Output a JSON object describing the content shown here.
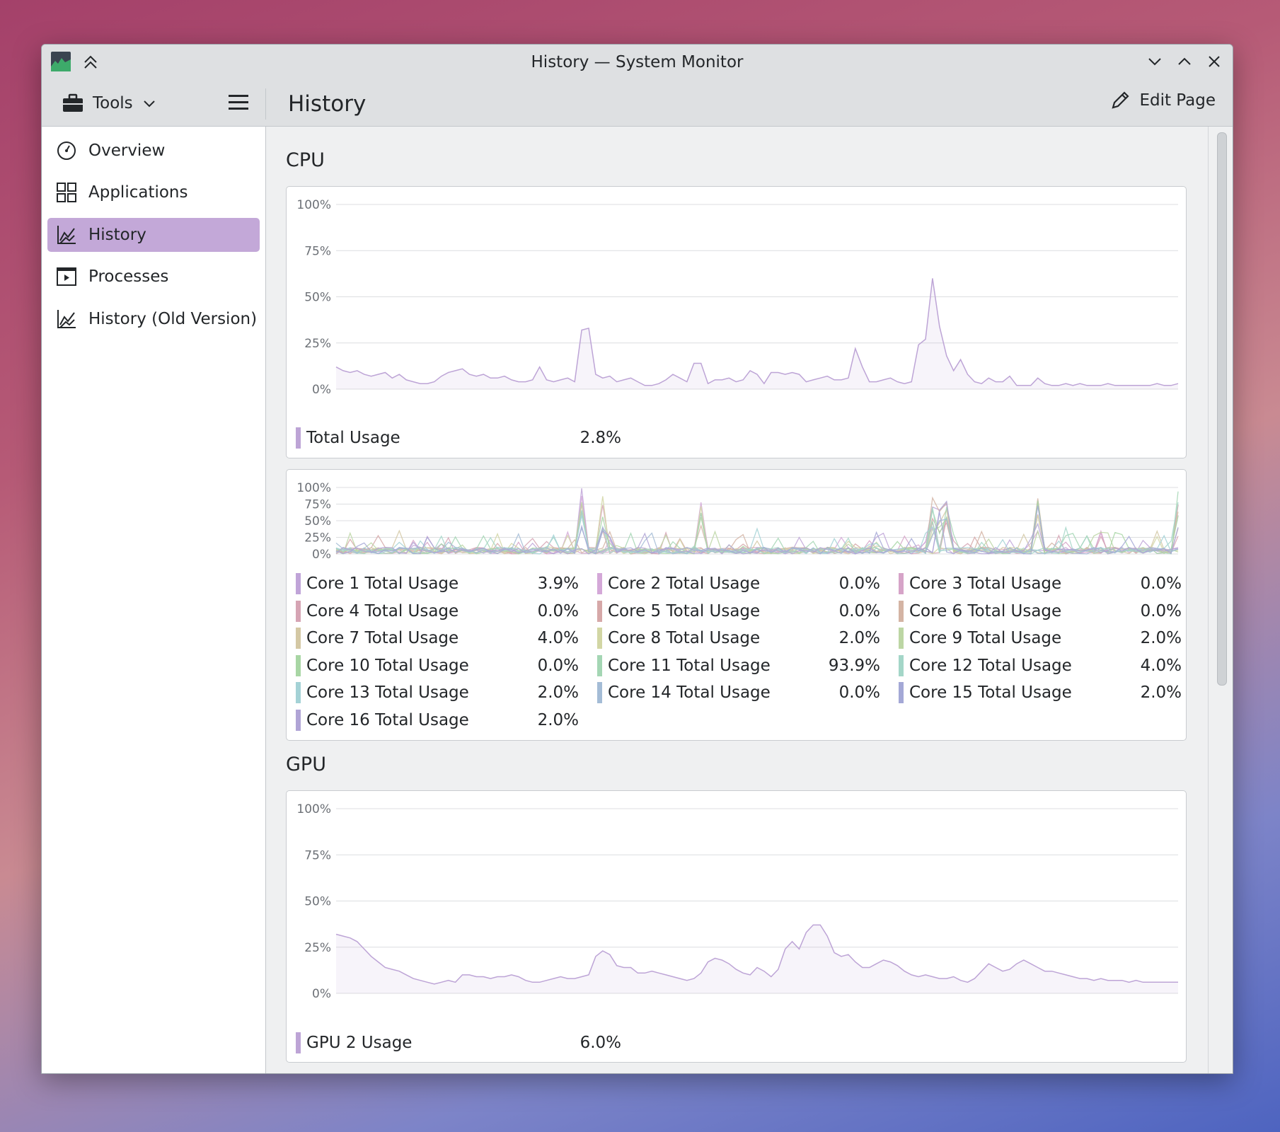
{
  "window": {
    "title": "History — System Monitor"
  },
  "toolbar": {
    "tools_label": "Tools",
    "page_title": "History",
    "edit_label": "Edit Page"
  },
  "sidebar": {
    "items": [
      {
        "label": "Overview",
        "icon": "speedometer-icon"
      },
      {
        "label": "Applications",
        "icon": "grid-icon"
      },
      {
        "label": "History",
        "icon": "chart-icon",
        "active": true
      },
      {
        "label": "Processes",
        "icon": "play-window-icon"
      },
      {
        "label": "History (Old Version)",
        "icon": "chart-icon"
      }
    ]
  },
  "cpu": {
    "heading": "CPU",
    "total": {
      "label": "Total Usage",
      "value": "2.8%",
      "color": "#bda4d6"
    },
    "cores": [
      {
        "label": "Core 1 Total Usage",
        "value": "3.9%",
        "color": "#c0a4d8"
      },
      {
        "label": "Core 2 Total Usage",
        "value": "0.0%",
        "color": "#d4a8d8"
      },
      {
        "label": "Core 3 Total Usage",
        "value": "0.0%",
        "color": "#d6a4c8"
      },
      {
        "label": "Core 4 Total Usage",
        "value": "0.0%",
        "color": "#d6a4b4"
      },
      {
        "label": "Core 5 Total Usage",
        "value": "0.0%",
        "color": "#d6a8a8"
      },
      {
        "label": "Core 6 Total Usage",
        "value": "0.0%",
        "color": "#d4b4a4"
      },
      {
        "label": "Core 7 Total Usage",
        "value": "4.0%",
        "color": "#d4c8a4"
      },
      {
        "label": "Core 8 Total Usage",
        "value": "2.0%",
        "color": "#d2d6a4"
      },
      {
        "label": "Core 9 Total Usage",
        "value": "2.0%",
        "color": "#bcd6a4"
      },
      {
        "label": "Core 10 Total Usage",
        "value": "0.0%",
        "color": "#a8d6a4"
      },
      {
        "label": "Core 11 Total Usage",
        "value": "93.9%",
        "color": "#a4d6b4"
      },
      {
        "label": "Core 12 Total Usage",
        "value": "4.0%",
        "color": "#a4d6c8"
      },
      {
        "label": "Core 13 Total Usage",
        "value": "2.0%",
        "color": "#a4d2d6"
      },
      {
        "label": "Core 14 Total Usage",
        "value": "0.0%",
        "color": "#a4bcd6"
      },
      {
        "label": "Core 15 Total Usage",
        "value": "2.0%",
        "color": "#a4a8d6"
      },
      {
        "label": "Core 16 Total Usage",
        "value": "2.0%",
        "color": "#b0a4d6"
      }
    ]
  },
  "gpu": {
    "heading": "GPU",
    "usage": {
      "label": "GPU 2 Usage",
      "value": "6.0%",
      "color": "#bda4d6"
    }
  },
  "chart_data": [
    {
      "type": "area",
      "ylim": [
        0,
        100
      ],
      "y_ticks": [
        "100%",
        "75%",
        "50%",
        "25%",
        "0%"
      ],
      "series": [
        {
          "name": "Total Usage",
          "values": [
            12,
            10,
            9,
            10,
            8,
            7,
            8,
            9,
            6,
            8,
            5,
            4,
            3,
            3,
            4,
            7,
            9,
            10,
            11,
            8,
            7,
            8,
            6,
            6,
            7,
            5,
            4,
            4,
            5,
            12,
            5,
            4,
            5,
            6,
            4,
            32,
            33,
            8,
            6,
            7,
            4,
            5,
            6,
            4,
            2,
            2,
            3,
            5,
            8,
            6,
            4,
            14,
            14,
            3,
            5,
            5,
            6,
            4,
            5,
            10,
            8,
            3,
            9,
            9,
            8,
            9,
            8,
            4,
            5,
            6,
            7,
            5,
            5,
            6,
            22,
            12,
            4,
            4,
            5,
            6,
            4,
            3,
            4,
            24,
            27,
            60,
            34,
            18,
            10,
            16,
            8,
            4,
            3,
            6,
            4,
            4,
            7,
            2,
            2,
            2,
            6,
            3,
            2,
            2,
            3,
            2,
            3,
            2,
            2,
            2,
            3,
            2,
            2,
            2,
            2,
            2,
            2,
            3,
            2,
            2,
            3
          ]
        }
      ]
    },
    {
      "type": "line",
      "ylim": [
        0,
        100
      ],
      "y_ticks": [
        "100%",
        "75%",
        "50%",
        "25%",
        "0%"
      ],
      "series_count": 16
    },
    {
      "type": "area",
      "ylim": [
        0,
        100
      ],
      "y_ticks": [
        "100%",
        "75%",
        "50%",
        "25%",
        "0%"
      ],
      "series": [
        {
          "name": "GPU 2 Usage",
          "values": [
            32,
            31,
            30,
            28,
            24,
            20,
            17,
            14,
            13,
            12,
            10,
            8,
            7,
            6,
            5,
            6,
            7,
            6,
            10,
            10,
            9,
            9,
            8,
            9,
            9,
            10,
            9,
            7,
            6,
            6,
            7,
            8,
            9,
            8,
            8,
            9,
            10,
            20,
            23,
            21,
            15,
            14,
            14,
            11,
            11,
            12,
            11,
            10,
            9,
            8,
            7,
            8,
            11,
            17,
            19,
            18,
            16,
            13,
            11,
            10,
            14,
            12,
            9,
            13,
            24,
            28,
            24,
            33,
            37,
            37,
            31,
            22,
            20,
            21,
            17,
            14,
            14,
            16,
            18,
            17,
            15,
            12,
            10,
            9,
            10,
            9,
            8,
            8,
            9,
            7,
            6,
            8,
            12,
            16,
            14,
            12,
            13,
            16,
            18,
            16,
            14,
            12,
            12,
            11,
            10,
            9,
            8,
            8,
            7,
            8,
            7,
            7,
            7,
            6,
            7,
            6,
            6,
            6,
            6,
            6,
            6
          ]
        }
      ]
    }
  ]
}
